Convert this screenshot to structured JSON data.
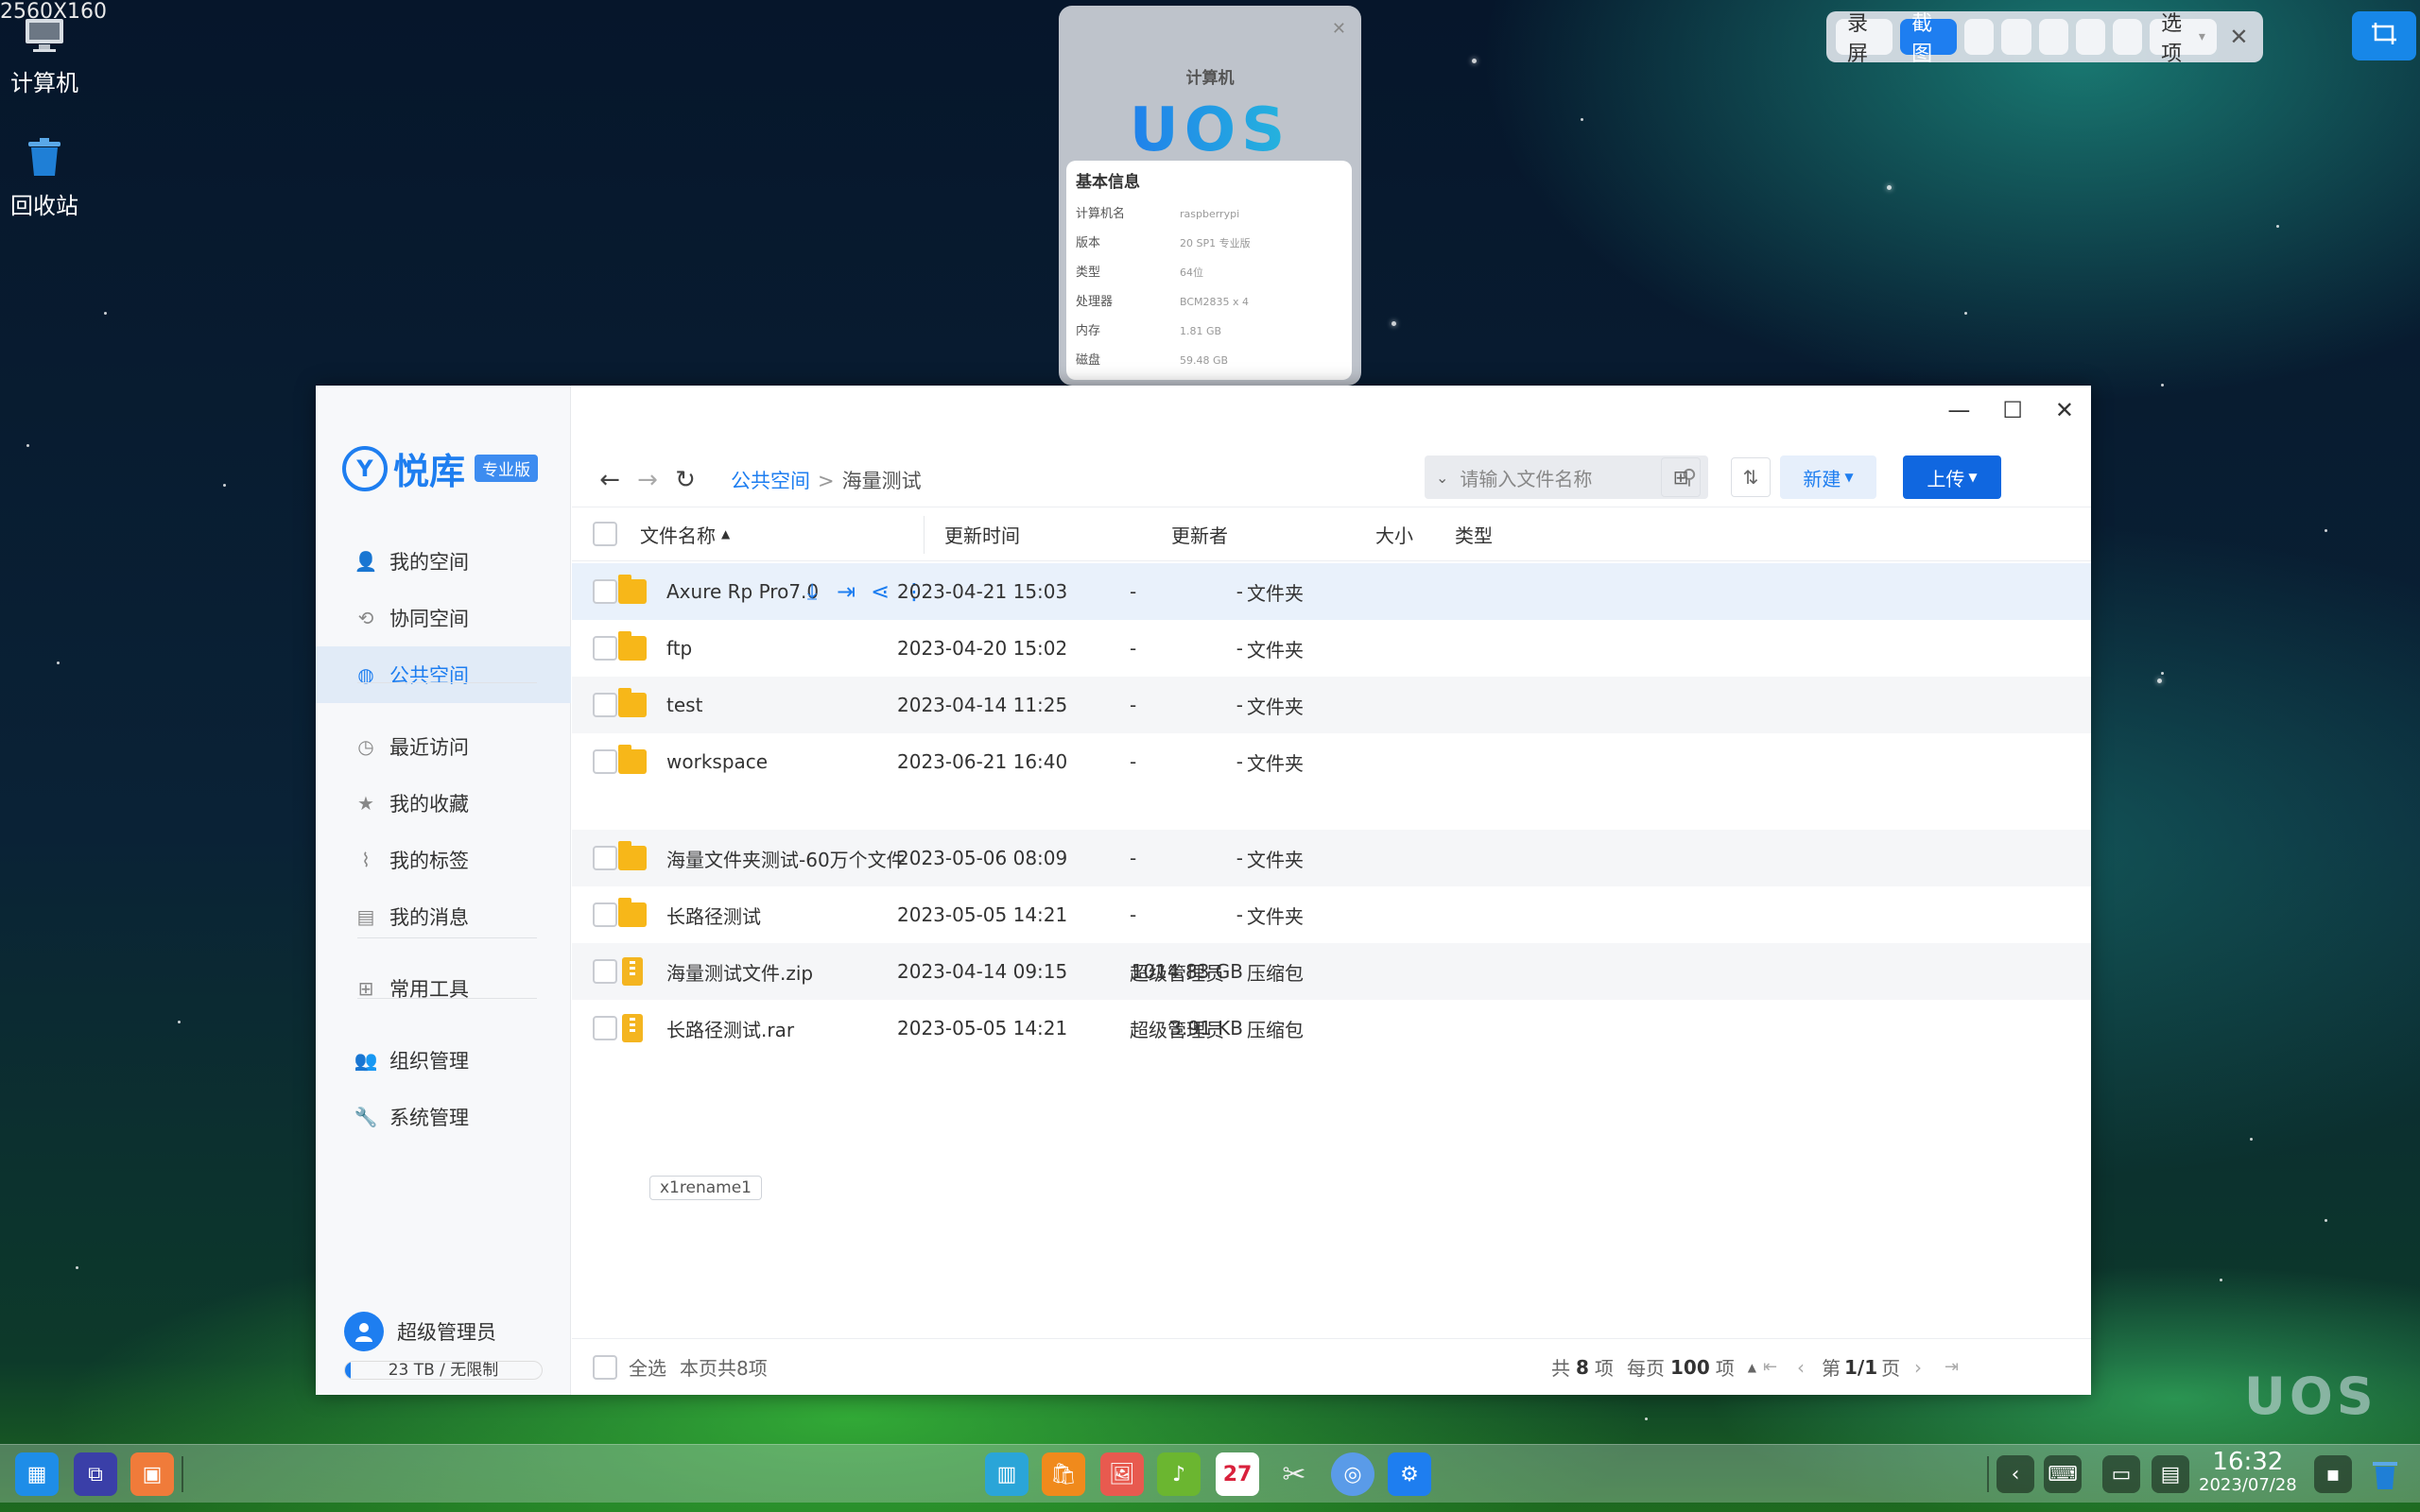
{
  "screen": {
    "dimension_label": "2560X160"
  },
  "desktop": {
    "icons": [
      {
        "label": "计算机",
        "icon": "computer-icon"
      },
      {
        "label": "回收站",
        "icon": "trash-icon"
      }
    ],
    "watermark": "UOS"
  },
  "screenshot_toolbar": {
    "record_label": "录屏",
    "capture_label": "截图",
    "options_label": "选项"
  },
  "info_popup": {
    "title": "计算机",
    "logo": "UOS",
    "section_title": "基本信息",
    "rows": [
      {
        "key": "计算机名",
        "value": "raspberrypi"
      },
      {
        "key": "版本",
        "value": "20 SP1 专业版"
      },
      {
        "key": "类型",
        "value": "64位"
      },
      {
        "key": "处理器",
        "value": "BCM2835 x 4"
      },
      {
        "key": "内存",
        "value": "1.81 GB"
      },
      {
        "key": "磁盘",
        "value": "59.48 GB"
      }
    ]
  },
  "app": {
    "brand": {
      "mark": "Y",
      "name": "悦库",
      "edition": "专业版"
    },
    "nav": [
      {
        "label": "我的空间",
        "icon": "user-icon"
      },
      {
        "label": "协同空间",
        "icon": "share-network-icon"
      },
      {
        "label": "公共空间",
        "icon": "globe-icon",
        "active": true
      },
      {
        "label": "最近访问",
        "icon": "history-icon"
      },
      {
        "label": "我的收藏",
        "icon": "star-icon"
      },
      {
        "label": "我的标签",
        "icon": "paperclip-icon"
      },
      {
        "label": "我的消息",
        "icon": "message-icon"
      },
      {
        "label": "常用工具",
        "icon": "grid-icon"
      },
      {
        "label": "组织管理",
        "icon": "org-user-icon"
      },
      {
        "label": "系统管理",
        "icon": "wrench-icon"
      }
    ],
    "user": {
      "name": "超级管理员",
      "quota": "23 TB / 无限制",
      "quota_fraction": 0.03
    },
    "breadcrumb": {
      "root": "公共空间",
      "sep": ">",
      "current": "海量测试"
    },
    "search": {
      "placeholder": "请输入文件名称"
    },
    "new_label": "新建",
    "upload_label": "上传",
    "columns": {
      "name": "文件名称",
      "time": "更新时间",
      "updater": "更新者",
      "size": "大小",
      "type": "类型"
    },
    "files": [
      {
        "name": "Axure Rp Pro7.0",
        "time": "2023-04-21 15:03",
        "updater": "-",
        "size": "-",
        "type": "文件夹",
        "kind": "folder"
      },
      {
        "name": "ftp",
        "time": "2023-04-20 15:02",
        "updater": "-",
        "size": "-",
        "type": "文件夹",
        "kind": "folder"
      },
      {
        "name": "test",
        "time": "2023-04-14 11:25",
        "updater": "-",
        "size": "-",
        "type": "文件夹",
        "kind": "folder"
      },
      {
        "name": "workspace",
        "time": "2023-06-21 16:40",
        "updater": "-",
        "size": "-",
        "type": "文件夹",
        "kind": "folder",
        "tag": "x1rename1"
      },
      {
        "name": "海量文件夹测试-60万个文件",
        "time": "2023-05-06 08:09",
        "updater": "-",
        "size": "-",
        "type": "文件夹",
        "kind": "folder"
      },
      {
        "name": "长路径测试",
        "time": "2023-05-05 14:21",
        "updater": "-",
        "size": "-",
        "type": "文件夹",
        "kind": "folder"
      },
      {
        "name": "海量测试文件.zip",
        "time": "2023-04-14 09:15",
        "updater": "超级管理员",
        "size": "1014.83 GB",
        "type": "压缩包",
        "kind": "zip"
      },
      {
        "name": "长路径测试.rar",
        "time": "2023-05-05 14:21",
        "updater": "超级管理员",
        "size": "3.91 KB",
        "type": "压缩包",
        "kind": "zip"
      }
    ],
    "footer": {
      "select_all": "全选",
      "page_count_text": "本页共8项",
      "total_prefix": "共",
      "total": "8",
      "total_suffix": "项",
      "per_page_prefix": "每页",
      "per_page": "100",
      "per_page_suffix": "项",
      "page_prefix": "第",
      "page": "1/1",
      "page_suffix": "页"
    }
  },
  "taskbar": {
    "clock_time": "16:32",
    "clock_date": "2023/07/28",
    "calendar_day": "27"
  }
}
